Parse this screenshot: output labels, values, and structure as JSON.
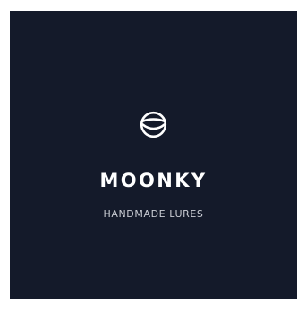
{
  "brand": {
    "name": "MOONKY",
    "tagline": "HANDMADE LURES",
    "logo_icon": "moon-lure-icon"
  },
  "colors": {
    "background": "#141a2a",
    "page": "#ffffff",
    "brand_text": "#ffffff",
    "tagline_text": "#c9ccd3"
  }
}
